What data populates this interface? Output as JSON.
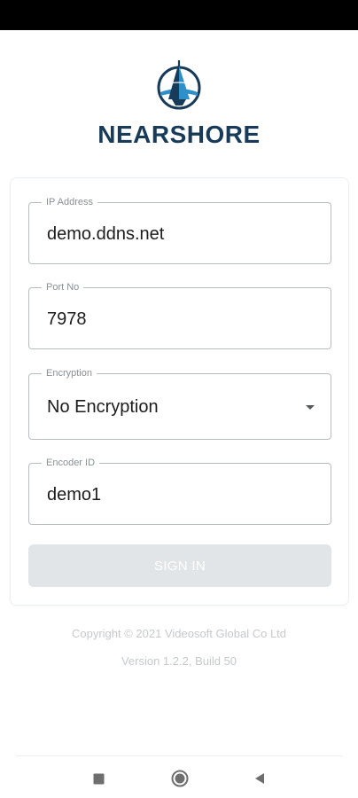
{
  "app": {
    "brand_name": "NEARSHORE"
  },
  "form": {
    "ip_address": {
      "label": "IP Address",
      "value": "demo.ddns.net"
    },
    "port": {
      "label": "Port No",
      "value": "7978"
    },
    "encryption": {
      "label": "Encryption",
      "selected": "No Encryption"
    },
    "encoder_id": {
      "label": "Encoder ID",
      "value": "demo1"
    },
    "sign_in_label": "SIGN IN"
  },
  "footer": {
    "copyright": "Copyright © 2021 Videosoft Global Co Ltd",
    "version": "Version 1.2.2, Build 50"
  },
  "colors": {
    "brand": "#173b59",
    "logo_accent": "#2f8fc9",
    "button_disabled": "#e1e5e8"
  },
  "nav": {
    "icons": [
      "square-icon",
      "circle-icon",
      "back-triangle-icon"
    ]
  }
}
